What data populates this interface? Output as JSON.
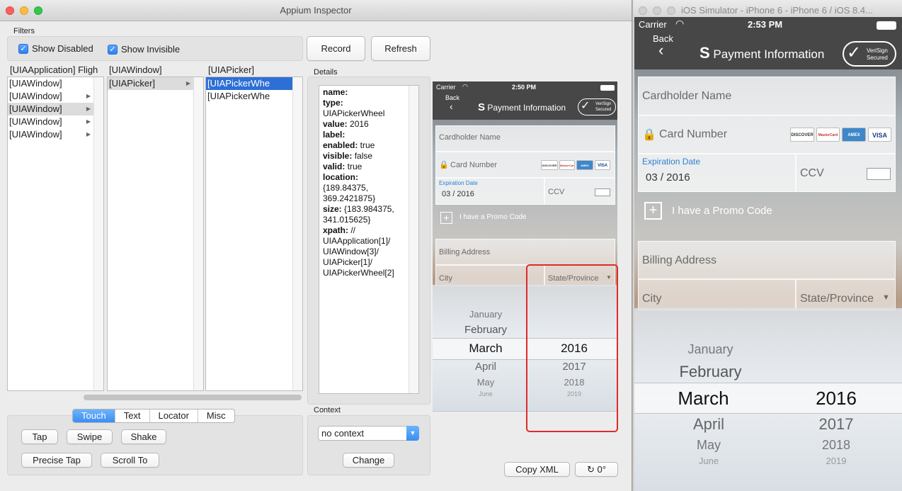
{
  "inspector": {
    "title": "Appium Inspector",
    "filters": {
      "label": "Filters",
      "show_disabled": "Show Disabled",
      "show_invisible": "Show Invisible",
      "check_mark": "✓"
    },
    "record_label": "Record",
    "refresh_label": "Refresh",
    "columns": [
      {
        "header": "[UIAApplication] Fligh",
        "items": [
          "[UIAWindow]",
          "[UIAWindow]",
          "[UIAWindow]",
          "[UIAWindow]",
          "[UIAWindow]"
        ]
      },
      {
        "header": "[UIAWindow]",
        "items": [
          "[UIAPicker]"
        ]
      },
      {
        "header": "[UIAPicker]",
        "items": [
          "[UIAPickerWhe",
          "[UIAPickerWhe"
        ]
      }
    ],
    "details": {
      "label": "Details",
      "lines": [
        {
          "k": "name:",
          "v": ""
        },
        {
          "k": "type:",
          "v": ""
        },
        {
          "k": "",
          "v": "UIAPickerWheel"
        },
        {
          "k": "value:",
          "v": " 2016"
        },
        {
          "k": "label:",
          "v": ""
        },
        {
          "k": "enabled:",
          "v": " true"
        },
        {
          "k": "visible:",
          "v": " false"
        },
        {
          "k": "valid:",
          "v": " true"
        },
        {
          "k": "location:",
          "v": ""
        },
        {
          "k": "",
          "v": "{189.84375,"
        },
        {
          "k": "",
          "v": "369.2421875}"
        },
        {
          "k": "size:",
          "v": " {183.984375,"
        },
        {
          "k": "",
          "v": "341.015625}"
        },
        {
          "k": "xpath:",
          "v": " //"
        },
        {
          "k": "",
          "v": "UIAApplication[1]/"
        },
        {
          "k": "",
          "v": "UIAWindow[3]/"
        },
        {
          "k": "",
          "v": "UIAPicker[1]/"
        },
        {
          "k": "",
          "v": "UIAPickerWheel[2]"
        }
      ]
    },
    "tabs": [
      "Touch",
      "Text",
      "Locator",
      "Misc"
    ],
    "actions": {
      "tap": "Tap",
      "swipe": "Swipe",
      "shake": "Shake",
      "precise_tap": "Precise Tap",
      "scroll_to": "Scroll To"
    },
    "context": {
      "label": "Context",
      "value": "no context",
      "change": "Change"
    },
    "copy_xml": "Copy XML",
    "rotation": "0°"
  },
  "phone": {
    "carrier": "Carrier",
    "back": "Back",
    "title": "Payment Information",
    "verisign_top": "VeriSign",
    "verisign_bottom": "Secured",
    "cardholder": "Cardholder Name",
    "card_number": "Card Number",
    "expiration_label": "Expiration Date",
    "expiration_value": "03 / 2016",
    "ccv": "CCV",
    "promo": "I have a Promo Code",
    "billing": "Billing Address",
    "city": "City",
    "state": "State/Province",
    "cards": [
      "DISCOVER",
      "MasterCard",
      "AMEX",
      "VISA"
    ],
    "months": [
      "January",
      "February",
      "March",
      "April",
      "May",
      "June"
    ],
    "years": [
      "2016",
      "2017",
      "2018",
      "2019"
    ],
    "small_time": "2:50 PM",
    "big_time": "2:53 PM"
  },
  "simulator": {
    "title": "iOS Simulator - iPhone 6 - iPhone 6 / iOS 8.4..."
  },
  "colors": {
    "accent": "#2d6fd6",
    "highlight": "#e02a2a"
  }
}
